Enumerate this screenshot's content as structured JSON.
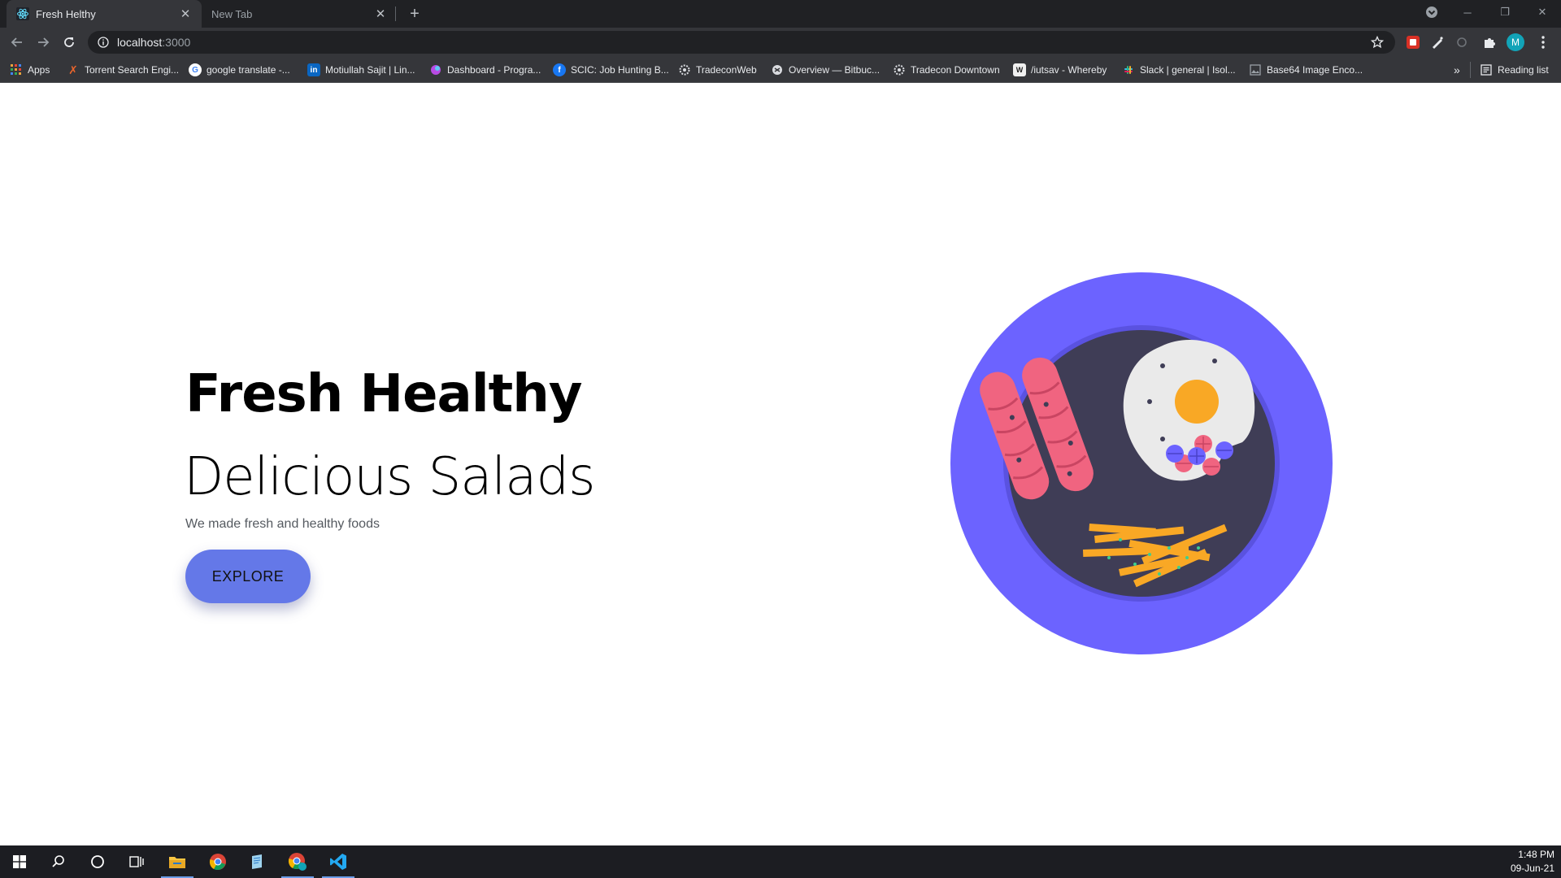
{
  "browser": {
    "tabs": [
      {
        "title": "Fresh Helthy",
        "active": true
      },
      {
        "title": "New Tab",
        "active": false
      }
    ],
    "address": {
      "host": "localhost",
      "port": ":3000"
    },
    "profile_initial": "M",
    "bookmarks": [
      {
        "label": "Apps",
        "icon": "apps-grid-icon",
        "color": "#e8a33c"
      },
      {
        "label": "Torrent Search Engi...",
        "icon": "torrent-x-icon",
        "color": "#e8642c"
      },
      {
        "label": "google translate -...",
        "icon": "google-icon",
        "color": "#4285f4"
      },
      {
        "label": "Motiullah Sajit | Lin...",
        "icon": "linkedin-icon",
        "color": "#0a66c2"
      },
      {
        "label": "Dashboard - Progra...",
        "icon": "dashboard-icon",
        "color": "#b84be3"
      },
      {
        "label": "SCIC: Job Hunting B...",
        "icon": "facebook-icon",
        "color": "#1877f2"
      },
      {
        "label": "TradeconWeb",
        "icon": "tradecon-icon",
        "color": "#dadce0"
      },
      {
        "label": "Overview — Bitbuc...",
        "icon": "bitbucket-icon",
        "color": "#dadce0"
      },
      {
        "label": "Tradecon Downtown",
        "icon": "tradecon-icon",
        "color": "#dadce0"
      },
      {
        "label": "/iutsav - Whereby",
        "icon": "whereby-icon",
        "color": "#f0f0f0"
      },
      {
        "label": "Slack | general | Isol...",
        "icon": "slack-icon",
        "color": "#e01e5a"
      },
      {
        "label": "Base64 Image Enco...",
        "icon": "image-icon",
        "color": "#9aa0a6"
      }
    ],
    "reading_list": "Reading list",
    "more_bookmarks": "»"
  },
  "hero": {
    "title": "Fresh Healthy",
    "subtitle": "Delicious Salads",
    "text": "We made fresh and healthy foods",
    "button": "EXPLORE"
  },
  "colors": {
    "plate_outer": "#6c63ff",
    "plate_inner": "#3f3d56",
    "sausage": "#f06480",
    "egg_white": "#eaeaea",
    "yolk": "#f9a825",
    "fries": "#f9a825",
    "button": "#6478e8"
  },
  "taskbar": {
    "time": "1:48 PM",
    "date": "09-Jun-21"
  }
}
